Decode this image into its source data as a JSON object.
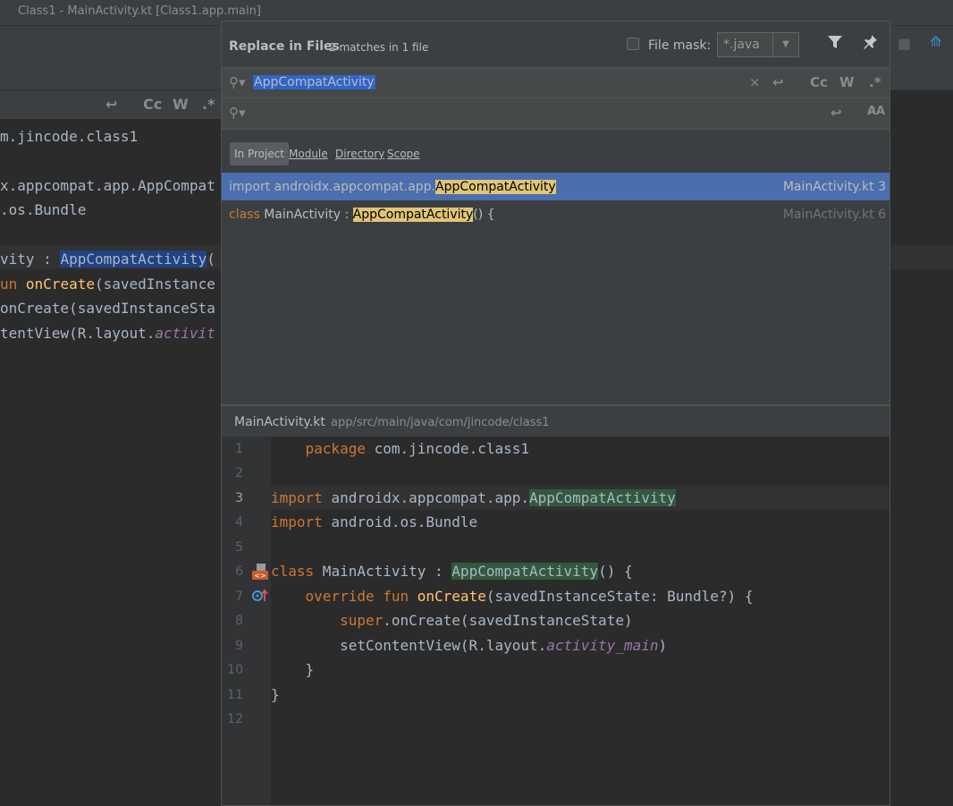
{
  "window": {
    "title": "Class1 - MainActivity.kt [Class1.app.main]"
  },
  "background_editor": {
    "lines": [
      {
        "text": "m.jincode.class1"
      },
      {
        "text": "x.appcompat.app.AppCompat"
      },
      {
        "text": ".os.Bundle"
      },
      {
        "a": "vity : ",
        "b": "AppCompatActivity",
        "c": "("
      },
      {
        "a": "un ",
        "b": "onCreate",
        "c": "(savedInstance"
      },
      {
        "text": "onCreate(savedInstanceSta"
      },
      {
        "a": "tentView(R.layout.",
        "b": "activit"
      }
    ]
  },
  "dialog": {
    "title": "Replace in Files",
    "matches": "2 matches in 1 file",
    "file_mask_label": "File mask:",
    "file_mask_value": "*.java",
    "find_text": "AppCompatActivity",
    "replace_text": "",
    "find_option_labels": {
      "case": "Cc",
      "words": "W",
      "regex": ".*"
    },
    "replace_option_label": "A̷A",
    "scopes": [
      {
        "label": "In Project",
        "active": true
      },
      {
        "label": "Module",
        "active": false
      },
      {
        "label": "Directory",
        "active": false
      },
      {
        "label": "Scope",
        "active": false
      }
    ],
    "results": [
      {
        "pre": "import androidx.appcompat.app.",
        "match": "AppCompatActivity",
        "post": "",
        "file": "MainActivity.kt 3",
        "selected": true
      },
      {
        "kw": "class ",
        "pre": "MainActivity : ",
        "match": "AppCompatActivity",
        "post": "() {",
        "file": "MainActivity.kt 6",
        "selected": false
      }
    ],
    "preview": {
      "file": "MainActivity.kt",
      "path": "app/src/main/java/com/jincode/class1",
      "current_line": 3,
      "line_numbers": [
        "1",
        "2",
        "3",
        "4",
        "5",
        "6",
        "7",
        "8",
        "9",
        "10",
        "11",
        "12"
      ],
      "lines": {
        "l1": {
          "kw": "package",
          "rest": " com.jincode.class1"
        },
        "l3": {
          "kw": "import",
          "rest": " androidx.appcompat.app.",
          "match": "AppCompatActivity"
        },
        "l4": {
          "kw": "import",
          "rest": " android.os.Bundle"
        },
        "l6": {
          "kw": "class",
          "rest": " MainActivity : ",
          "match": "AppCompatActivity",
          "post": "() {"
        },
        "l7": {
          "kw1": "override",
          "kw2": " fun ",
          "fn": "onCreate",
          "rest": "(savedInstanceState: Bundle?) {"
        },
        "l8": {
          "kw": "super",
          "rest": ".onCreate(savedInstanceState)"
        },
        "l9": {
          "rest": "setContentView(R.layout.",
          "it": "activity_main",
          "post": ")"
        },
        "l10": {
          "rest": "}"
        },
        "l11": {
          "rest": "}"
        }
      }
    }
  },
  "colors": {
    "accent": "#4b6eaf",
    "highlight": "#e1c576",
    "keyword": "#cc7832",
    "function": "#ffc66d"
  }
}
